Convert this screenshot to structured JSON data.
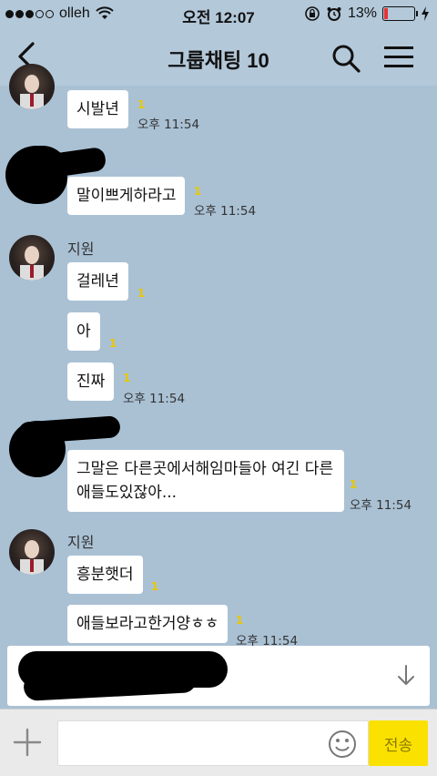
{
  "status_bar": {
    "carrier": "olleh",
    "time": "오전 12:07",
    "battery": "13%",
    "battery_level": 0.13
  },
  "header": {
    "title": "그룹채팅",
    "member_count": "10"
  },
  "messages": [
    {
      "sender": "",
      "text": "시발년",
      "unread": "1",
      "time": "오후 11:54"
    },
    {
      "sender": "",
      "text": "말이쁘게하라고",
      "unread": "1",
      "time": "오후 11:54"
    },
    {
      "sender": "지원",
      "text": "걸레년",
      "unread": "1",
      "time": ""
    },
    {
      "sender": "",
      "text": "아",
      "unread": "1",
      "time": ""
    },
    {
      "sender": "",
      "text": "진짜",
      "unread": "1",
      "time": "오후 11:54"
    },
    {
      "sender": "",
      "text": "그말은 다른곳에서해임마들아 여긴 다른\n애들도있잖아...",
      "unread": "1",
      "time": "오후 11:54"
    },
    {
      "sender": "지원",
      "text": "흥분햇더",
      "unread": "1",
      "time": ""
    },
    {
      "sender": "",
      "text": "애들보라고한거양ㅎㅎ",
      "unread": "1",
      "time": "오후 11:54"
    }
  ],
  "input_bar": {
    "placeholder": "",
    "send_label": "전송"
  },
  "colors": {
    "chat_background": "#aac1d4",
    "send_button": "#fae100",
    "unread_count": "#e8c700"
  },
  "icons": [
    "back-arrow-icon",
    "search-icon",
    "menu-icon",
    "down-arrow-icon",
    "plus-icon",
    "emoji-icon"
  ]
}
